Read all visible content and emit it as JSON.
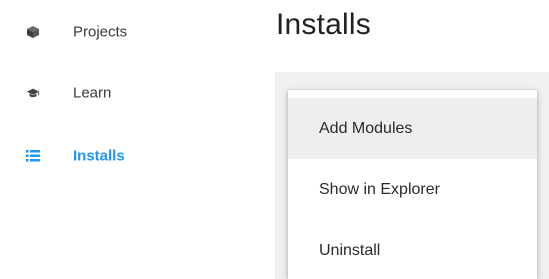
{
  "sidebar": {
    "items": [
      {
        "label": "Projects",
        "icon": "cube-icon",
        "active": false
      },
      {
        "label": "Learn",
        "icon": "graduation-cap-icon",
        "active": false
      },
      {
        "label": "Installs",
        "icon": "list-icon",
        "active": true
      }
    ]
  },
  "main": {
    "title": "Installs"
  },
  "context_menu": {
    "items": [
      {
        "label": "Add Modules",
        "highlighted": true
      },
      {
        "label": "Show in Explorer",
        "highlighted": false
      },
      {
        "label": "Uninstall",
        "highlighted": false
      }
    ]
  },
  "colors": {
    "accent": "#2196f3",
    "text": "#3a3a3a",
    "title": "#212121",
    "panel_background": "#f0f0f0",
    "menu_highlight": "#eeeeee"
  }
}
